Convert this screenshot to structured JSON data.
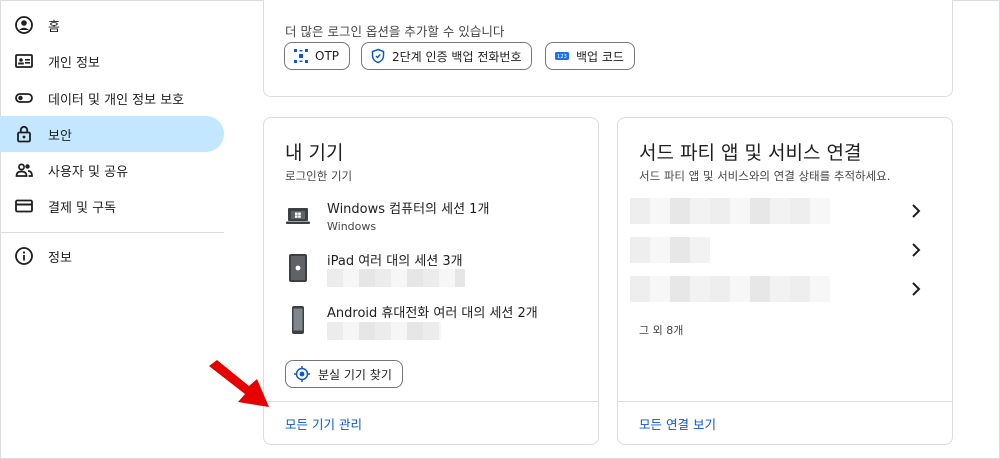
{
  "sidebar": {
    "items": [
      {
        "label": "홈",
        "icon": "account-circle-icon"
      },
      {
        "label": "개인 정보",
        "icon": "id-card-icon"
      },
      {
        "label": "데이터 및 개인 정보 보호",
        "icon": "toggle-icon"
      },
      {
        "label": "보안",
        "icon": "lock-icon",
        "active": true
      },
      {
        "label": "사용자 및 공유",
        "icon": "people-icon"
      },
      {
        "label": "결제 및 구독",
        "icon": "credit-card-icon"
      },
      {
        "label": "정보",
        "icon": "info-icon"
      }
    ]
  },
  "signin_options": {
    "hint": "더 많은 로그인 옵션을 추가할 수 있습니다",
    "chips": [
      {
        "label": "OTP",
        "icon": "otp-icon"
      },
      {
        "label": "2단계 인증 백업 전화번호",
        "icon": "shield-icon"
      },
      {
        "label": "백업 코드",
        "icon": "backup-code-icon"
      }
    ]
  },
  "devices": {
    "title": "내 기기",
    "subtitle": "로그인한 기기",
    "items": [
      {
        "title": "Windows 컴퓨터의 세션 1개",
        "detail": "Windows",
        "icon": "laptop-icon"
      },
      {
        "title": "iPad 여러 대의 세션 3개",
        "detail": "",
        "icon": "tablet-icon"
      },
      {
        "title": "Android 휴대전화 여러 대의 세션 2개",
        "detail": "",
        "icon": "phone-icon"
      }
    ],
    "find_button": "분실 기기 찾기",
    "manage_link": "모든 기기 관리"
  },
  "third_party": {
    "title": "서드 파티 앱 및 서비스 연결",
    "subtitle": "서드 파티 앱 및 서비스와의 연결 상태를 추적하세요.",
    "more_count": "그 외 8개",
    "view_all_link": "모든 연결 보기"
  },
  "colors": {
    "accent": "#0b57d0",
    "active_nav": "#c2e7ff",
    "annotation_arrow": "#e60000"
  }
}
